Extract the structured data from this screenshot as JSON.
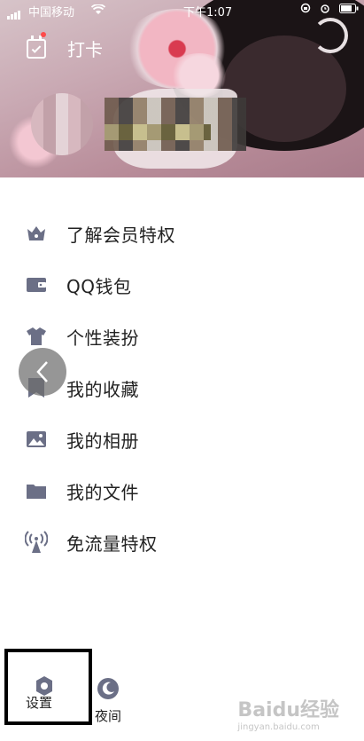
{
  "status_bar": {
    "carrier": "中国移动",
    "time": "下午1:07"
  },
  "header": {
    "clock_in_label": "打卡"
  },
  "menu": {
    "items": [
      {
        "label": "了解会员特权",
        "icon": "crown-icon"
      },
      {
        "label": "QQ钱包",
        "icon": "wallet-icon"
      },
      {
        "label": "个性装扮",
        "icon": "tshirt-icon"
      },
      {
        "label": "我的收藏",
        "icon": "bookmark-icon"
      },
      {
        "label": "我的相册",
        "icon": "photo-icon"
      },
      {
        "label": "我的文件",
        "icon": "folder-icon"
      },
      {
        "label": "免流量特权",
        "icon": "signal-tower-icon"
      }
    ]
  },
  "bottom_bar": {
    "settings_label": "设置",
    "night_label": "夜间"
  },
  "watermark": {
    "text": "Baidu经验",
    "sub": "jingyan.baidu.com"
  },
  "colors": {
    "icon": "#6b6f86",
    "highlight_border": "#000000"
  }
}
